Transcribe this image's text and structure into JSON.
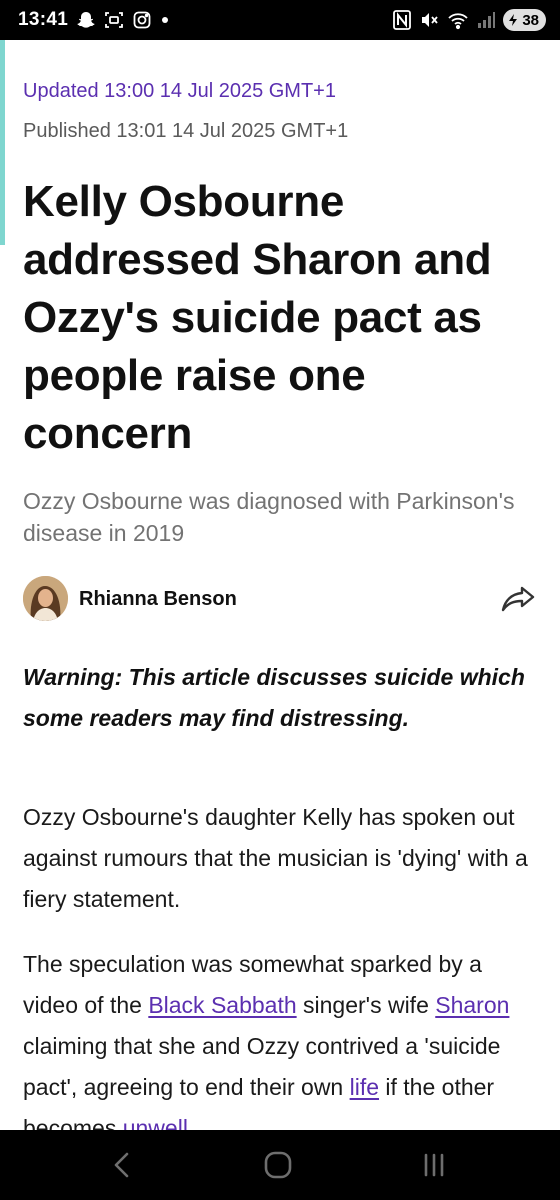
{
  "status_bar": {
    "time": "13:41",
    "battery": "38",
    "icons": [
      "snapchat-icon",
      "screenshot-icon",
      "instagram-icon",
      "dot-icon",
      "nfc-icon",
      "mute-icon",
      "wifi-icon",
      "signal-icon"
    ]
  },
  "article": {
    "updated": "Updated 13:00 14 Jul 2025 GMT+1",
    "published": "Published 13:01 14 Jul 2025 GMT+1",
    "headline": "Kelly Osbourne addressed Sharon and Ozzy's suicide pact as people raise one concern",
    "subheading": "Ozzy Osbourne was diagnosed with Parkinson's disease in 2019",
    "author": "Rhianna Benson",
    "warning": "Warning: This article discusses suicide which some readers may find distressing.",
    "paragraph1": "Ozzy Osbourne's daughter Kelly has spoken out against rumours that the musician is 'dying' with a fiery statement.",
    "paragraph2": {
      "t1": "The speculation was somewhat sparked by a video of the ",
      "link1": "Black Sabbath",
      "t2": " singer's wife ",
      "link2": "Sharon",
      "t3": " claiming that she and Ozzy contrived a 'suicide pact', agreeing to end their own ",
      "link3": "life",
      "t4": " if the other becomes ",
      "link4": "unwell",
      "t5": "."
    }
  },
  "colors": {
    "accent": "#7fd6cf",
    "link": "#5b2fb0",
    "meta_gray": "#5a5a5a",
    "subheading_gray": "#737373"
  },
  "nav_bar": {
    "buttons": [
      "back-icon",
      "home-icon",
      "recents-icon"
    ]
  }
}
